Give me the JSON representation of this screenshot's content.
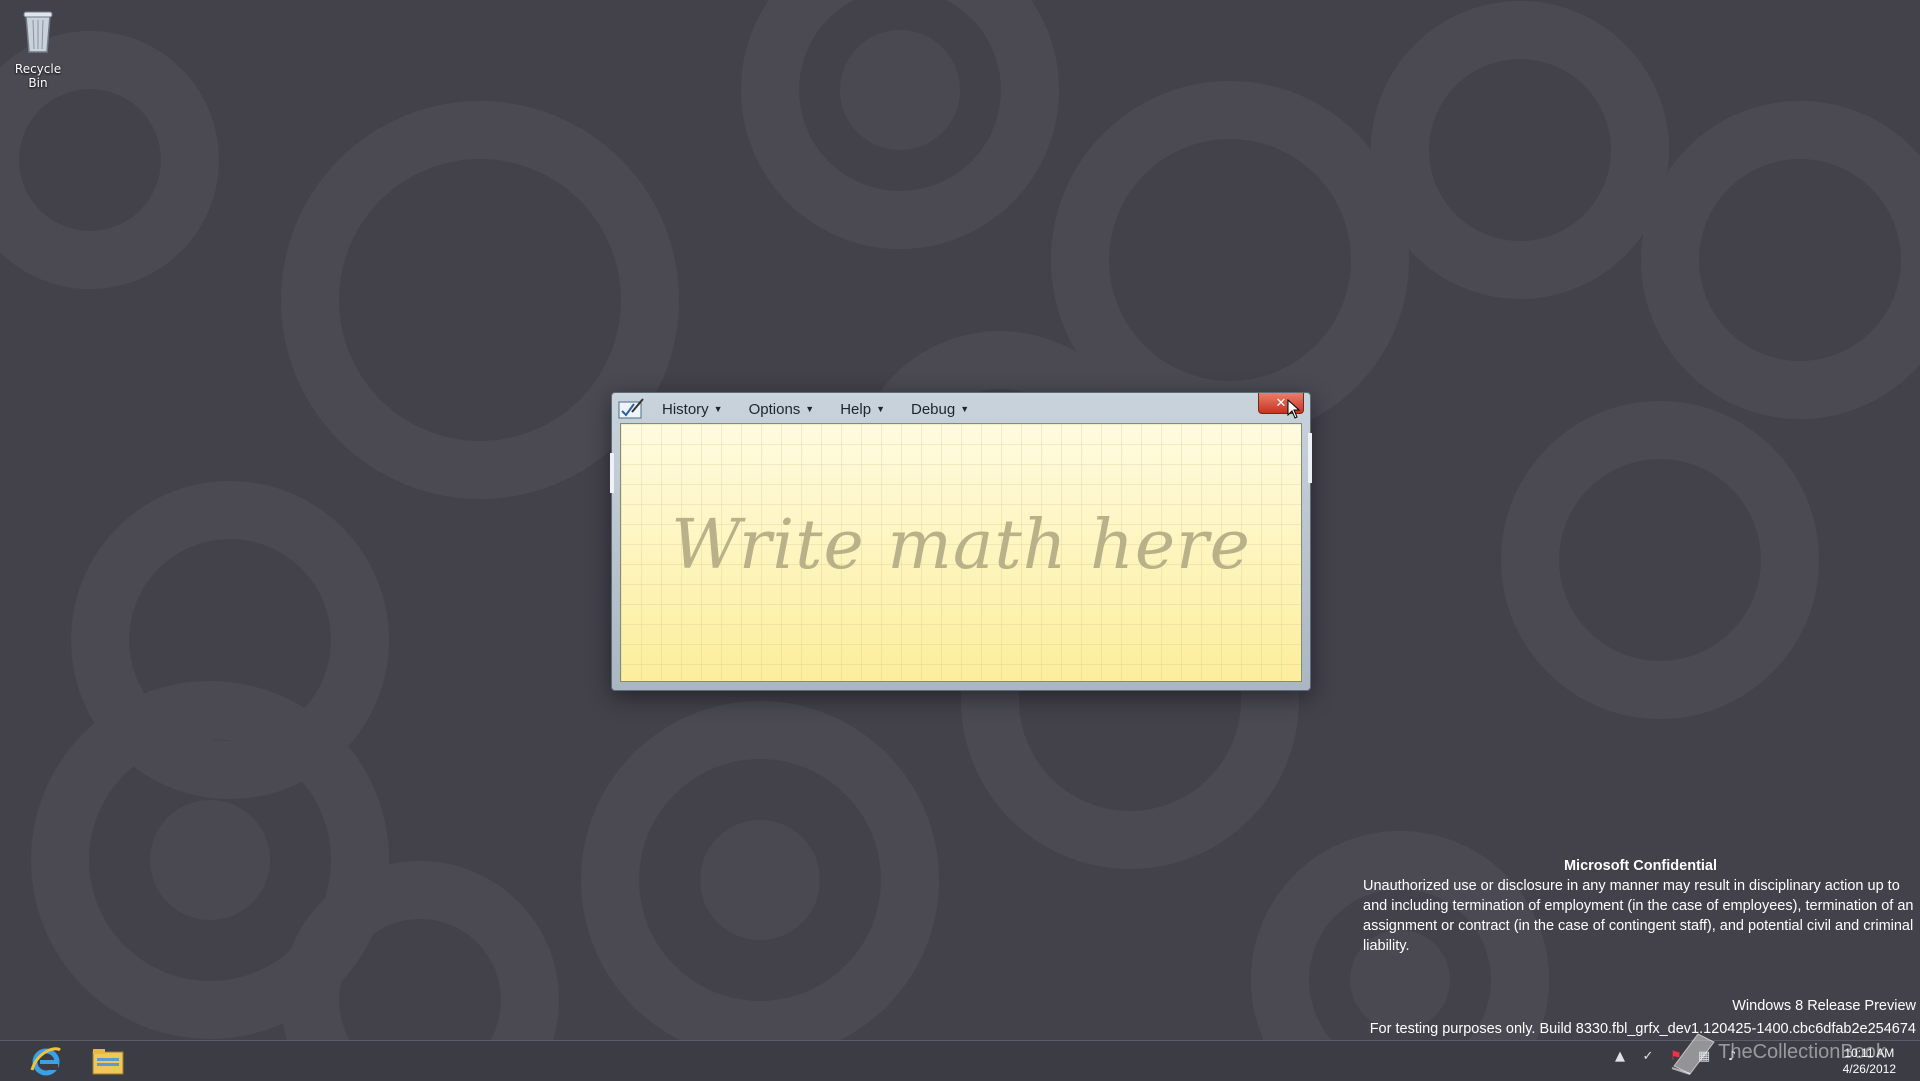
{
  "desktop": {
    "recycle_bin_label": "Recycle Bin"
  },
  "window": {
    "menu": [
      {
        "label": "History"
      },
      {
        "label": "Options"
      },
      {
        "label": "Help"
      },
      {
        "label": "Debug"
      }
    ],
    "close_glyph": "✕",
    "writing_prompt": "Write math here"
  },
  "confidential": {
    "heading": "Microsoft Confidential",
    "body": "Unauthorized use or disclosure in any manner may result in disciplinary action up to and including termination of employment (in the case of employees), termination of an assignment or contract (in the case of contingent staff), and potential civil and criminal liability."
  },
  "build": {
    "edition": "Windows 8 Release Preview",
    "info": "For testing purposes only. Build 8330.fbl_grfx_dev1.120425-1400.cbc6dfab2e254674"
  },
  "taskbar": {
    "pinned": [
      {
        "icon": "internet-explorer-icon"
      },
      {
        "icon": "file-explorer-icon"
      }
    ],
    "clock_time": "10:11 AM",
    "clock_date": "4/26/2012"
  },
  "watermark": "TheCollectionBook",
  "colors": {
    "desktop": "#43424b",
    "pad": "#fdf6c4",
    "close": "#c6331f"
  }
}
